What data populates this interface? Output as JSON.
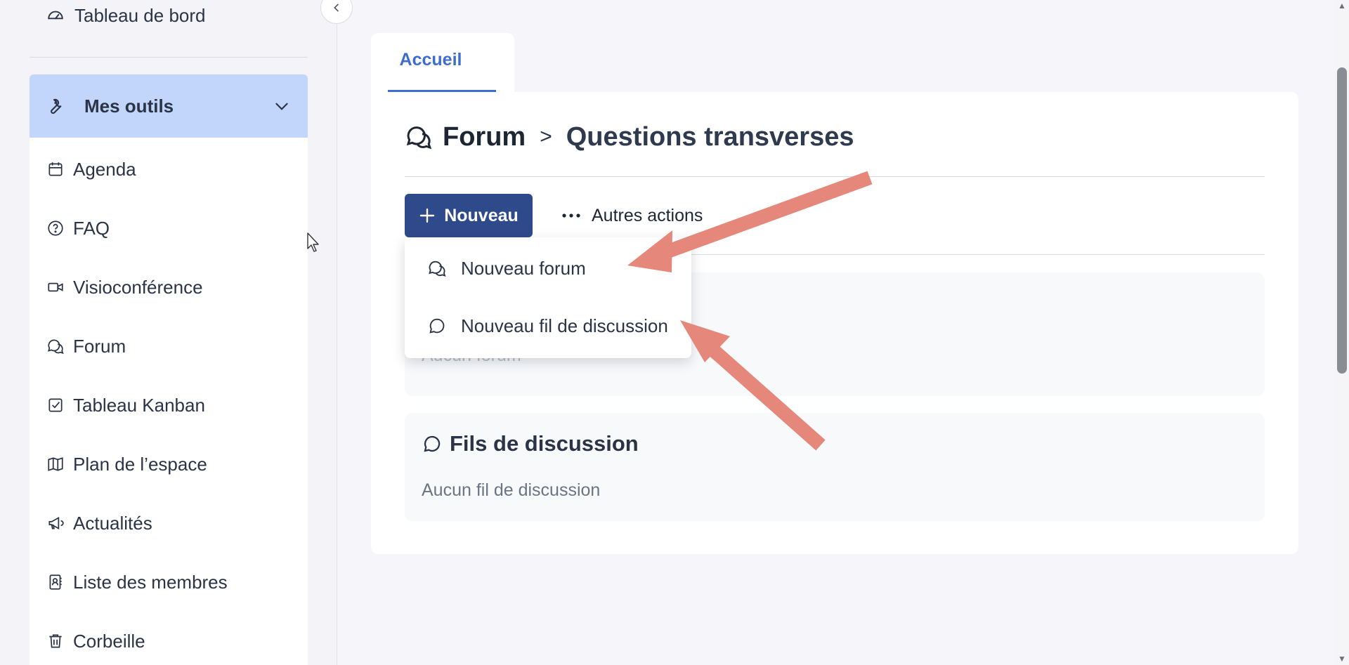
{
  "sidebar": {
    "dashboard_label": "Tableau de bord",
    "tools_header": "Mes outils",
    "items": [
      {
        "label": "Agenda",
        "icon": "calendar-icon"
      },
      {
        "label": "FAQ",
        "icon": "help-circle-icon"
      },
      {
        "label": "Visioconférence",
        "icon": "video-icon"
      },
      {
        "label": "Forum",
        "icon": "forum-icon"
      },
      {
        "label": "Tableau Kanban",
        "icon": "checkbox-icon"
      },
      {
        "label": "Plan de l’espace",
        "icon": "map-icon"
      },
      {
        "label": "Actualités",
        "icon": "megaphone-icon"
      },
      {
        "label": "Liste des membres",
        "icon": "contacts-icon"
      },
      {
        "label": "Corbeille",
        "icon": "trash-icon"
      }
    ]
  },
  "tabs": {
    "home_label": "Accueil"
  },
  "header": {
    "root": "Forum",
    "separator": ">",
    "current": "Questions transverses"
  },
  "toolbar": {
    "new_label": "Nouveau",
    "more_label": "Autres actions"
  },
  "dropdown": {
    "items": [
      {
        "label": "Nouveau forum",
        "icon": "forum-icon"
      },
      {
        "label": "Nouveau fil de discussion",
        "icon": "chat-bubble-icon"
      }
    ]
  },
  "sections": {
    "forums_empty": "Aucun forum",
    "threads_title": "Fils de discussion",
    "threads_empty": "Aucun fil de discussion"
  },
  "colors": {
    "accent": "#3e6ecd",
    "primary_button": "#2f4a8a",
    "tools_header_bg": "#c2d5fb",
    "annotation_arrow": "#e5877a"
  }
}
